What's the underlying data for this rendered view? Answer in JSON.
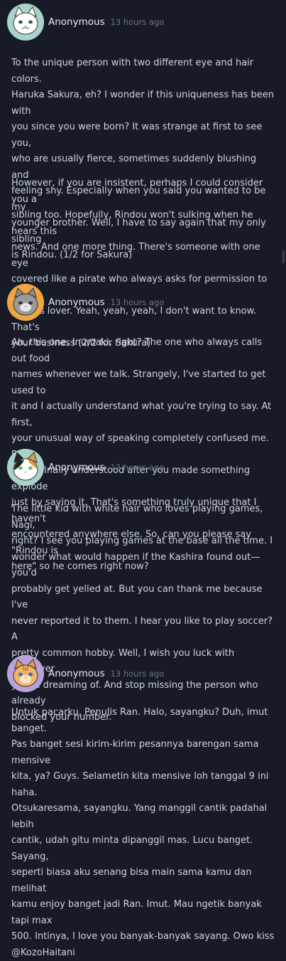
{
  "posts": [
    {
      "author": "Anonymous",
      "time": "13 hours ago",
      "avatar_icon": "white-cat-icon",
      "avatar_bg": "#a9d3c8",
      "paragraphs": [
        "To the unique person with two different eye and hair colors.\nHaruka Sakura, eh? I wonder if this uniqueness has been with\nyou since you were born? It was strange at first to see you,\nwho are usually fierce, sometimes suddenly blushing and\nfeeling shy. Especially when you said you wanted to be my\nyounger brother. Well, I have to say again that my only sibling\nis Rindou. (1/2 for Sakura)",
        "However, if you are insistent, perhaps I could consider you a\nsibling too. Hopefully, Rindou won't sulking when he hears this\nnews. And one more thing. There's someone with one eye\ncovered like a pirate who always asks for permission to make\nyou his lover. Yeah, yeah, yeah, I don't want to know. That's\nyour business (2/2 for Sakura)"
      ]
    },
    {
      "author": "Anonymous",
      "time": "13 hours ago",
      "avatar_icon": "gray-cat-icon",
      "avatar_bg": "#f0a640",
      "paragraphs": [
        "Ah, this one. Inumaki, right? The one who always calls out food\nnames whenever we talk. Strangely, I've started to get used to\nit and I actually understand what you're trying to say. At first,\nyour unusual way of speaking completely confused me. But\nthen I finally understood after you made something explode\njust by saying it. That's something truly unique that I haven't\nencountered anywhere else. So, can you please say \"Rindou is\nhere\" so he comes right now?"
      ]
    },
    {
      "author": "Anonymous",
      "time": "13 hours ago",
      "avatar_icon": "calico-cat-icon",
      "avatar_bg": "#a9d3c8",
      "paragraphs": [
        "The little kid with white hair who loves playing games, Nagi,\nright? I see you playing games at the base all the time. I\nwonder what would happen if the Kashira found out—you'd\nprobably get yelled at. But you can thank me because I've\nnever reported it to them. I hear you like to play soccer? A\npretty common hobby. Well, I wish you luck with whatever\nyou're dreaming of. And stop missing the person who already\nblocked your number."
      ]
    },
    {
      "author": "Anonymous",
      "time": "13 hours ago",
      "avatar_icon": "orange-cat-icon",
      "avatar_bg": "#b9a2dc",
      "paragraphs": [
        "Untuk pacarku, Penulis Ran. Halo, sayangku? Duh, imut banget.\nPas banget sesi kirim-kirim pesannya barengan sama mensive\nkita, ya? Guys. Selametin kita mensive loh tanggal 9 ini haha.\nOtsukaresama, sayangku. Yang manggil cantik padahal lebih\ncantik, udah gitu minta dipanggil mas. Lucu banget. Sayang,\nseperti biasa aku senang bisa main sama kamu dan melihat\nkamu enjoy banget jadi Ran. Imut. Mau ngetik banyak tapi max\n500. Intinya, I love you banyak-banyak sayang. Owo kiss\n@KozoHaitani"
      ]
    }
  ]
}
